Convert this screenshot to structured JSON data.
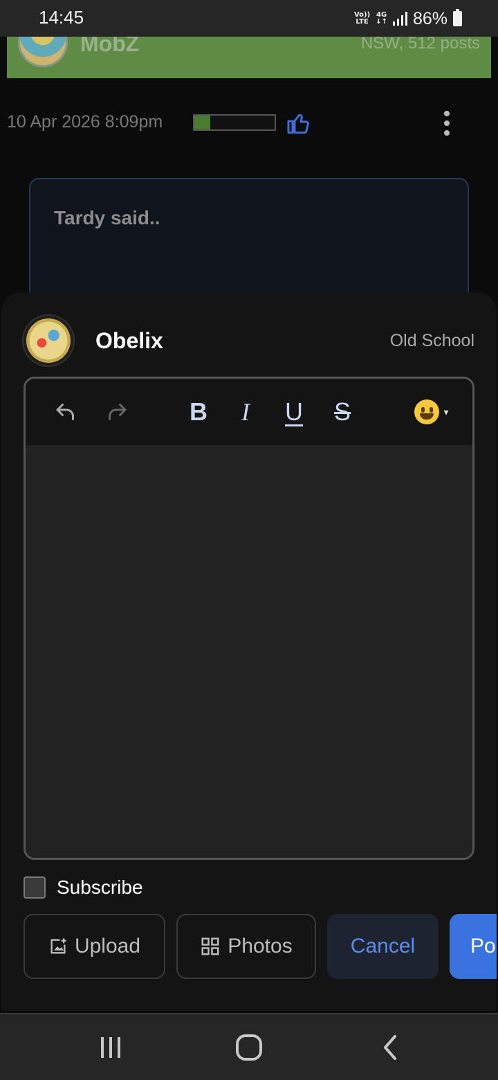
{
  "status_bar": {
    "time": "14:45",
    "volte_top": "Vo))",
    "volte_bottom": "LTE",
    "network_top": "4G",
    "network_bottom": "↓↑",
    "battery": "86%"
  },
  "thread": {
    "banner_name": "MobZ",
    "banner_meta": "NSW, 512 posts",
    "post_date": "10 Apr 2026 8:09pm",
    "reputation_level": 0.2,
    "quote_title": "Tardy said.."
  },
  "composer": {
    "user_name": "Obelix",
    "user_rank": "Old School",
    "toolbar": {
      "bold": "B",
      "italic": "I",
      "underline": "U",
      "strike": "S",
      "emoji_caret": "▾"
    },
    "subscribe_label": "Subscribe",
    "buttons": {
      "upload": "Upload",
      "photos": "Photos",
      "cancel": "Cancel",
      "post": "Post"
    }
  },
  "colors": {
    "banner": "#5f8c45",
    "accent_blue": "#3a73e0",
    "cancel_text": "#5b8def",
    "reputation": "#4a7c2f"
  }
}
